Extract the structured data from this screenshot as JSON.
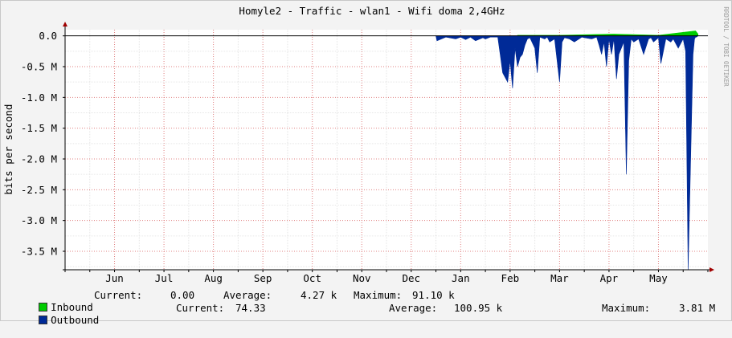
{
  "chart_data": {
    "type": "area",
    "title": "Homyle2 - Traffic - wlan1 - Wifi doma 2,4GHz",
    "ylabel": "bits per second",
    "watermark": "RRDTOOL / TOBI OETIKER",
    "ylim": [
      -3.8,
      0.1
    ],
    "y_ticks": [
      {
        "value": 0.0,
        "label": "0.0"
      },
      {
        "value": -0.5,
        "label": "-0.5 M"
      },
      {
        "value": -1.0,
        "label": "-1.0 M"
      },
      {
        "value": -1.5,
        "label": "-1.5 M"
      },
      {
        "value": -2.0,
        "label": "-2.0 M"
      },
      {
        "value": -2.5,
        "label": "-2.5 M"
      },
      {
        "value": -3.0,
        "label": "-3.0 M"
      },
      {
        "value": -3.5,
        "label": "-3.5 M"
      }
    ],
    "x_ticks": [
      {
        "month": 1,
        "label": "Jun"
      },
      {
        "month": 2,
        "label": "Jul"
      },
      {
        "month": 3,
        "label": "Aug"
      },
      {
        "month": 4,
        "label": "Sep"
      },
      {
        "month": 5,
        "label": "Oct"
      },
      {
        "month": 6,
        "label": "Nov"
      },
      {
        "month": 7,
        "label": "Dec"
      },
      {
        "month": 8,
        "label": "Jan"
      },
      {
        "month": 9,
        "label": "Feb"
      },
      {
        "month": 10,
        "label": "Mar"
      },
      {
        "month": 11,
        "label": "Apr"
      },
      {
        "month": 12,
        "label": "May"
      }
    ],
    "series": [
      {
        "name": "Inbound",
        "color": "#00cc00",
        "x": [
          9.15,
          9.6,
          10.0,
          11.1,
          12.0,
          12.75,
          12.8
        ],
        "values": [
          0.01,
          0.01,
          0.01,
          0.03,
          0.01,
          0.08,
          0.03
        ]
      },
      {
        "name": "Outbound",
        "color": "#002a97",
        "x": [
          7.5,
          7.52,
          7.7,
          7.9,
          8.0,
          8.1,
          8.2,
          8.3,
          8.45,
          8.5,
          8.6,
          8.75,
          8.8,
          8.85,
          8.95,
          9.0,
          9.05,
          9.1,
          9.15,
          9.2,
          9.25,
          9.3,
          9.35,
          9.4,
          9.5,
          9.55,
          9.6,
          9.7,
          9.75,
          9.8,
          9.9,
          10.0,
          10.05,
          10.1,
          10.2,
          10.3,
          10.45,
          10.5,
          10.65,
          10.75,
          10.8,
          10.85,
          10.9,
          10.95,
          11.0,
          11.05,
          11.1,
          11.15,
          11.2,
          11.3,
          11.35,
          11.4,
          11.45,
          11.5,
          11.6,
          11.7,
          11.8,
          11.85,
          11.9,
          12.0,
          12.05,
          12.15,
          12.25,
          12.3,
          12.4,
          12.5,
          12.55,
          12.6,
          12.7,
          12.73,
          12.75,
          12.77,
          12.8,
          12.85,
          13.0
        ],
        "values": [
          0,
          -0.08,
          -0.02,
          -0.05,
          -0.02,
          -0.06,
          -0.02,
          -0.08,
          -0.03,
          -0.05,
          -0.02,
          -0.02,
          -0.3,
          -0.6,
          -0.75,
          -0.4,
          -0.85,
          -0.2,
          -0.5,
          -0.35,
          -0.3,
          -0.15,
          -0.05,
          -0.03,
          -0.2,
          -0.6,
          -0.02,
          -0.05,
          -0.02,
          -0.1,
          -0.05,
          -0.75,
          -0.1,
          -0.03,
          -0.05,
          -0.1,
          -0.02,
          -0.03,
          -0.05,
          -0.02,
          -0.15,
          -0.3,
          -0.1,
          -0.5,
          -0.05,
          -0.3,
          -0.05,
          -0.7,
          -0.3,
          -0.1,
          -2.25,
          -0.4,
          -0.05,
          -0.1,
          -0.05,
          -0.3,
          -0.05,
          -0.03,
          -0.1,
          -0.03,
          -0.45,
          -0.05,
          -0.1,
          -0.05,
          -0.2,
          -0.05,
          -0.25,
          -3.8,
          -0.3,
          -0.05,
          -0.02,
          -0.02,
          0,
          0,
          0
        ]
      }
    ]
  },
  "legend": {
    "inbound": {
      "label": "Inbound",
      "current_label": "Current:",
      "current": "0.00",
      "average_label": "Average:",
      "average": "4.27 k",
      "maximum_label": "Maximum:",
      "maximum": "91.10 k"
    },
    "outbound": {
      "label": "Outbound",
      "current_label": "Current:",
      "current": "74.33",
      "average_label": "Average:",
      "average": "100.95 k",
      "maximum_label": "Maximum:",
      "maximum": "3.81 M"
    }
  }
}
